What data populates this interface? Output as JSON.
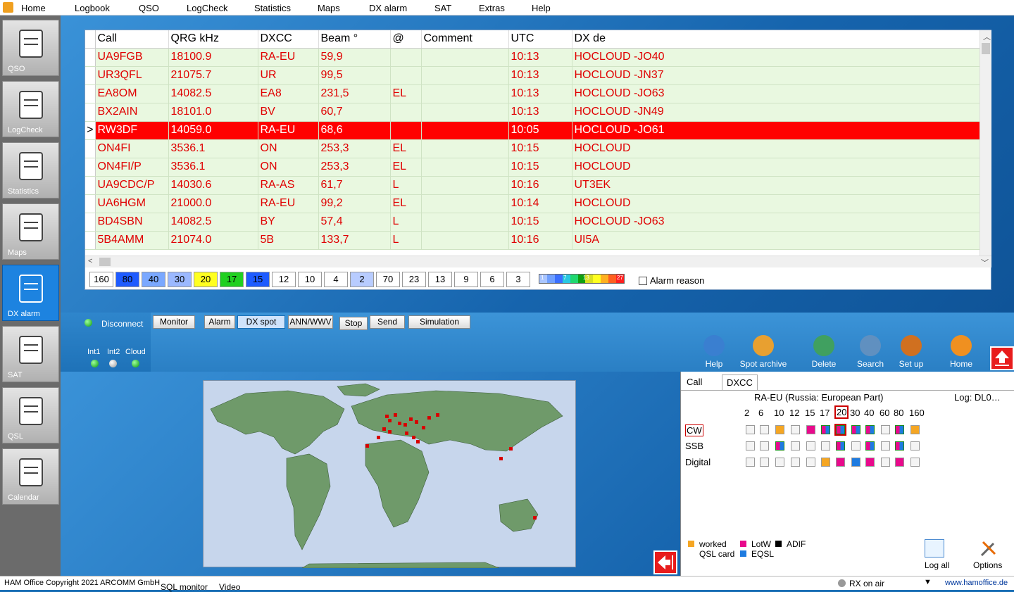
{
  "menu": [
    "Home",
    "Logbook",
    "QSO",
    "LogCheck",
    "Statistics",
    "Maps",
    "DX alarm",
    "SAT",
    "Extras",
    "Help"
  ],
  "sidebar": [
    {
      "label": "QSO",
      "icon": "qso-icon"
    },
    {
      "label": "LogCheck",
      "icon": "logcheck-icon"
    },
    {
      "label": "Statistics",
      "icon": "statistics-icon"
    },
    {
      "label": "Maps",
      "icon": "maps-icon"
    },
    {
      "label": "DX alarm",
      "icon": "dx-alarm-icon"
    },
    {
      "label": "SAT",
      "icon": "sat-icon"
    },
    {
      "label": "QSL",
      "icon": "qsl-icon"
    },
    {
      "label": "Calendar",
      "icon": "calendar-icon"
    }
  ],
  "table": {
    "headers": [
      "Call",
      "QRG kHz",
      "DXCC",
      "Beam °",
      "@",
      "Comment",
      "UTC",
      "DX de"
    ],
    "rows": [
      [
        "UA9FGB",
        "18100.9",
        "RA-EU",
        "59,9",
        "",
        "",
        "10:13",
        "HOCLOUD -JO40"
      ],
      [
        "UR3QFL",
        "21075.7",
        "UR",
        "99,5",
        "",
        "",
        "10:13",
        "HOCLOUD -JN37"
      ],
      [
        "EA8OM",
        "14082.5",
        "EA8",
        "231,5",
        "EL",
        "",
        "10:13",
        "HOCLOUD -JO63"
      ],
      [
        "BX2AIN",
        "18101.0",
        "BV",
        "60,7",
        "",
        "",
        "10:13",
        "HOCLOUD -JN49"
      ],
      [
        "RW3DF",
        "14059.0",
        "RA-EU",
        "68,6",
        "",
        "",
        "10:05",
        "HOCLOUD -JO61"
      ],
      [
        "ON4FI",
        "3536.1",
        "ON",
        "253,3",
        "EL",
        "",
        "10:15",
        "HOCLOUD"
      ],
      [
        "ON4FI/P",
        "3536.1",
        "ON",
        "253,3",
        "EL",
        "",
        "10:15",
        "HOCLOUD"
      ],
      [
        "UA9CDC/P",
        "14030.6",
        "RA-AS",
        "61,7",
        "L",
        "",
        "10:16",
        "UT3EK"
      ],
      [
        "UA6HGM",
        "21000.0",
        "RA-EU",
        "99,2",
        "EL",
        "",
        "10:14",
        "HOCLOUD"
      ],
      [
        "BD4SBN",
        "14082.5",
        "BY",
        "57,4",
        "L",
        "",
        "10:15",
        "HOCLOUD -JO63"
      ],
      [
        "5B4AMM",
        "21074.0",
        "5B",
        "133,7",
        "L",
        "",
        "10:16",
        "UI5A"
      ]
    ],
    "selected_row": 4,
    "selected_indicator": ">"
  },
  "bands": [
    {
      "label": "160",
      "color": "#ffffff"
    },
    {
      "label": "80",
      "color": "#1e5bff"
    },
    {
      "label": "40",
      "color": "#7aa8ff"
    },
    {
      "label": "30",
      "color": "#9bb8ff"
    },
    {
      "label": "20",
      "color": "#ffff20"
    },
    {
      "label": "17",
      "color": "#20d020"
    },
    {
      "label": "15",
      "color": "#1e5bff"
    },
    {
      "label": "12",
      "color": "#ffffff"
    },
    {
      "label": "10",
      "color": "#ffffff"
    },
    {
      "label": "4",
      "color": "#ffffff"
    },
    {
      "label": "2",
      "color": "#b8ccff"
    },
    {
      "label": "70",
      "color": "#ffffff"
    },
    {
      "label": "23",
      "color": "#ffffff"
    },
    {
      "label": "13",
      "color": "#ffffff"
    },
    {
      "label": "9",
      "color": "#ffffff"
    },
    {
      "label": "6",
      "color": "#ffffff"
    },
    {
      "label": "3",
      "color": "#ffffff"
    }
  ],
  "legend_scale": {
    "labels": [
      "1",
      "7",
      "13",
      "27"
    ],
    "colors": [
      "#a9c5ff",
      "#6f9fff",
      "#3a6fff",
      "#28c8e0",
      "#20d870",
      "#10a010",
      "#d8e020",
      "#ffff20",
      "#ffb020",
      "#ff6020",
      "#ff2020"
    ]
  },
  "alarm_reason": "Alarm reason",
  "connection": {
    "disconnect": "Disconnect",
    "int1": "Int1",
    "int2": "Int2",
    "cloud": "Cloud"
  },
  "controls": [
    "Monitor",
    "Alarm",
    "DX spot",
    "ANN/WWV",
    "Stop",
    "Send",
    "Simulation"
  ],
  "toolbar": [
    {
      "label": "Help",
      "icon": "help-icon"
    },
    {
      "label": "Spot archive",
      "icon": "spot-archive-icon"
    },
    {
      "label": "Delete",
      "icon": "delete-icon"
    },
    {
      "label": "Search",
      "icon": "search-icon"
    },
    {
      "label": "Set up",
      "icon": "setup-icon"
    },
    {
      "label": "Home",
      "icon": "home-icon"
    }
  ],
  "dxcc": {
    "tabs": [
      "Call",
      "DXCC"
    ],
    "entity": "RA-EU (Russia: European Part)",
    "log": "Log: DL0…",
    "bands": [
      "2",
      "6",
      "10",
      "12",
      "15",
      "17",
      "20",
      "30",
      "40",
      "60",
      "80",
      "160"
    ],
    "modes": [
      "CW",
      "SSB",
      "Digital"
    ],
    "legend": [
      "worked",
      "LotW",
      "ADIF",
      "QSL card",
      "EQSL"
    ],
    "buttons": [
      "Log all",
      "Options"
    ]
  },
  "footer": {
    "copyright": "HAM Office Copyright 2021 ARCOMM GmbH",
    "sql_monitor": "SQL monitor",
    "video": "Video",
    "rx": "RX on air",
    "url": "www.hamoffice.de"
  }
}
